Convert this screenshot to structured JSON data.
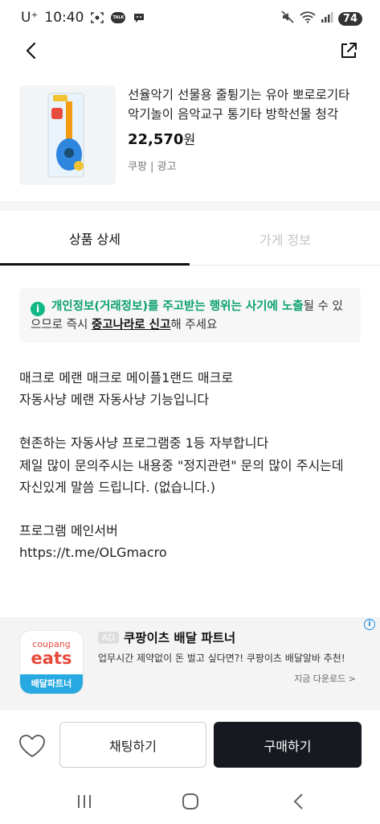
{
  "status": {
    "carrier": "U⁺",
    "time": "10:40",
    "talk_badge": "TALK",
    "battery": "74"
  },
  "nav": {
    "back_icon": "chevron-left-icon",
    "share_icon": "external-link-icon"
  },
  "product": {
    "title": "선율악기 선물용 줄튕기는 유아 뽀로로기타 악기놀이 음악교구 통기타 방학선물 청각",
    "price": "22,570",
    "price_unit": "원",
    "source": "쿠팡 | 광고"
  },
  "tabs": [
    {
      "label": "상품 상세",
      "active": true
    },
    {
      "label": "가게 정보",
      "active": false
    }
  ],
  "notice": {
    "highlight": "개인정보(거래정보)를 주고받는 행위는 사기에 노출",
    "middle": "될 수 있으므로 즉시 ",
    "report_link": "중고나라로 신고",
    "tail": "해 주세요"
  },
  "description": {
    "lines": [
      "매크로 메랜 매크로 메이플1랜드 매크로",
      "자동사냥 메랜 자동사냥 기능입니다",
      "",
      "현존하는 자동사냥 프로그램중 1등 자부합니다",
      "제일 많이 문의주시는 내용중 \"정지관련\" 문의 많이 주시는데",
      "자신있게 말씀 드립니다. (없습니다.)",
      "",
      "프로그램 메인서버",
      "https://t.me/OLGmacro"
    ]
  },
  "ad": {
    "logo_top": "coupang",
    "logo_big": "eats",
    "logo_strip": "배달파트너",
    "badge": "AD",
    "title": "쿠팡이츠 배달 파트너",
    "subtitle": "업무시간 제약없이 돈 벌고 싶다면?! 쿠팡이츠 배달알바 추천!",
    "cta": "지금 다운로드 >",
    "info_icon": "i"
  },
  "actions": {
    "chat_label": "채팅하기",
    "buy_label": "구매하기"
  },
  "colors": {
    "notice_green": "#0aa06e",
    "buy_button": "#16191f",
    "ad_blue": "#27a9e1",
    "coupang_red": "#e8483a"
  }
}
